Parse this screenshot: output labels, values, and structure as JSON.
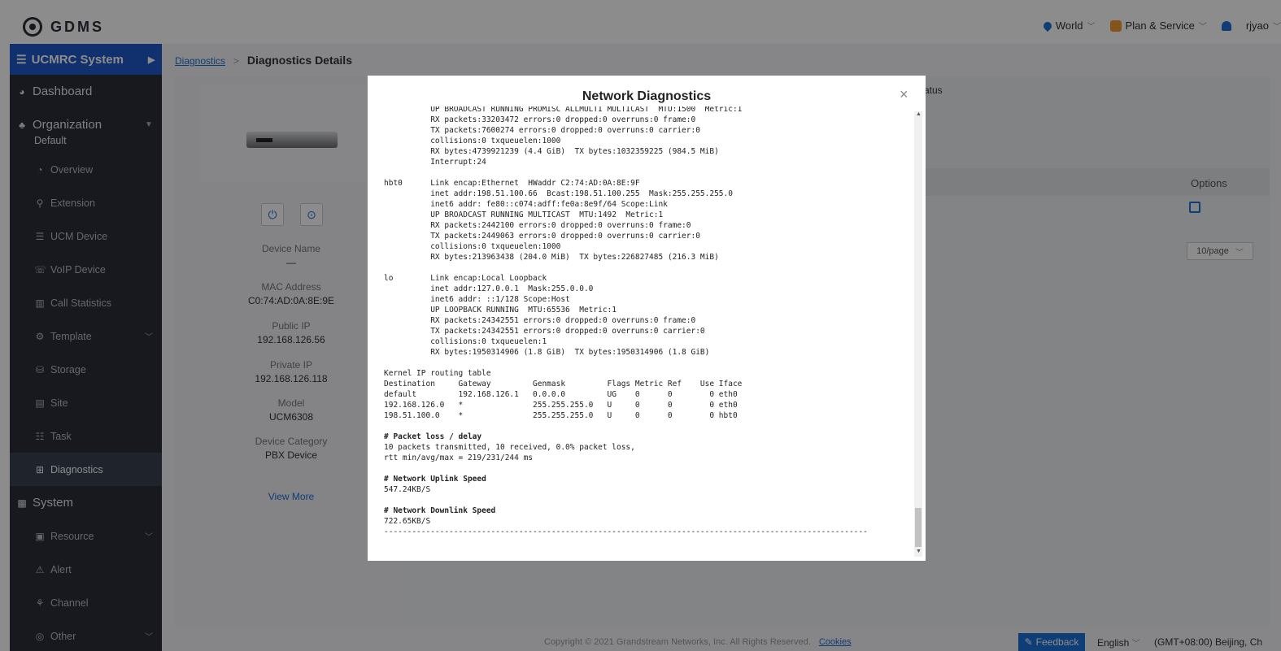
{
  "topbar": {
    "logo": "GDMS",
    "region": "World",
    "plan": "Plan & Service",
    "user": "rjyao"
  },
  "sidebar": {
    "header": "UCMRC System",
    "dashboard": "Dashboard",
    "organization": "Organization",
    "org_default": "Default",
    "items": [
      {
        "label": "Overview",
        "icon": "pie-chart-icon"
      },
      {
        "label": "Extension",
        "icon": "user-icon"
      },
      {
        "label": "UCM Device",
        "icon": "server-icon"
      },
      {
        "label": "VoIP Device",
        "icon": "phone-icon"
      },
      {
        "label": "Call Statistics",
        "icon": "bar-chart-icon"
      },
      {
        "label": "Template",
        "icon": "gear-icon"
      },
      {
        "label": "Storage",
        "icon": "database-icon"
      },
      {
        "label": "Site",
        "icon": "site-icon"
      },
      {
        "label": "Task",
        "icon": "list-icon"
      },
      {
        "label": "Diagnostics",
        "icon": "diagnostics-icon"
      }
    ],
    "system": "System",
    "system_items": [
      {
        "label": "Resource",
        "icon": "resource-icon"
      },
      {
        "label": "Alert",
        "icon": "alert-icon"
      },
      {
        "label": "Channel",
        "icon": "channel-icon"
      },
      {
        "label": "Other",
        "icon": "other-icon"
      }
    ]
  },
  "breadcrumb": {
    "parent": "Diagnostics",
    "separator": ">",
    "current": "Diagnostics Details"
  },
  "device": {
    "name_label": "Device Name",
    "name_value": "—",
    "mac_label": "MAC Address",
    "mac_value": "C0:74:AD:0A:8E:9E",
    "public_ip_label": "Public IP",
    "public_ip_value": "192.168.126.56",
    "private_ip_label": "Private IP",
    "private_ip_value": "192.168.126.118",
    "model_label": "Model",
    "model_value": "UCM6308",
    "category_label": "Device Category",
    "category_value": "PBX Device",
    "view_more": "View More"
  },
  "right": {
    "status_fragment": "atus",
    "options_label": "Options",
    "pager": "10/page"
  },
  "footer": {
    "copyright": "Copyright © 2021 Grandstream Networks, Inc. All Rights Reserved.",
    "cookies": "Cookies",
    "feedback": "Feedback",
    "language": "English",
    "timezone": "(GMT+08:00) Beijing, Ch"
  },
  "modal": {
    "title": "Network Diagnostics",
    "close": "×",
    "lines": [
      "          UP BROADCAST RUNNING PROMISC ALLMULTI MULTICAST  MTU:1500  Metric:1",
      "          RX packets:33203472 errors:0 dropped:0 overruns:0 frame:0",
      "          TX packets:7600274 errors:0 dropped:0 overruns:0 carrier:0",
      "          collisions:0 txqueuelen:1000",
      "          RX bytes:4739921239 (4.4 GiB)  TX bytes:1032359225 (984.5 MiB)",
      "          Interrupt:24",
      "",
      "hbt0      Link encap:Ethernet  HWaddr C2:74:AD:0A:8E:9F",
      "          inet addr:198.51.100.66  Bcast:198.51.100.255  Mask:255.255.255.0",
      "          inet6 addr: fe80::c074:adff:fe0a:8e9f/64 Scope:Link",
      "          UP BROADCAST RUNNING MULTICAST  MTU:1492  Metric:1",
      "          RX packets:2442100 errors:0 dropped:0 overruns:0 frame:0",
      "          TX packets:2449063 errors:0 dropped:0 overruns:0 carrier:0",
      "          collisions:0 txqueuelen:1000",
      "          RX bytes:213963438 (204.0 MiB)  TX bytes:226827485 (216.3 MiB)",
      "",
      "lo        Link encap:Local Loopback",
      "          inet addr:127.0.0.1  Mask:255.0.0.0",
      "          inet6 addr: ::1/128 Scope:Host",
      "          UP LOOPBACK RUNNING  MTU:65536  Metric:1",
      "          RX packets:24342551 errors:0 dropped:0 overruns:0 frame:0",
      "          TX packets:24342551 errors:0 dropped:0 overruns:0 carrier:0",
      "          collisions:0 txqueuelen:1",
      "          RX bytes:1950314906 (1.8 GiB)  TX bytes:1950314906 (1.8 GiB)",
      "",
      "Kernel IP routing table",
      "Destination     Gateway         Genmask         Flags Metric Ref    Use Iface",
      "default         192.168.126.1   0.0.0.0         UG    0      0        0 eth0",
      "192.168.126.0   *               255.255.255.0   U     0      0        0 eth0",
      "198.51.100.0    *               255.255.255.0   U     0      0        0 hbt0",
      "",
      "**# Packet loss / delay",
      "10 packets transmitted, 10 received, 0.0% packet loss,",
      "rtt min/avg/max = 219/231/244 ms",
      "",
      "**# Network Uplink Speed",
      "547.24KB/S",
      "",
      "**# Network Downlink Speed",
      "722.65KB/S",
      "--------------------------------------------------------------------------------------------------------"
    ]
  }
}
